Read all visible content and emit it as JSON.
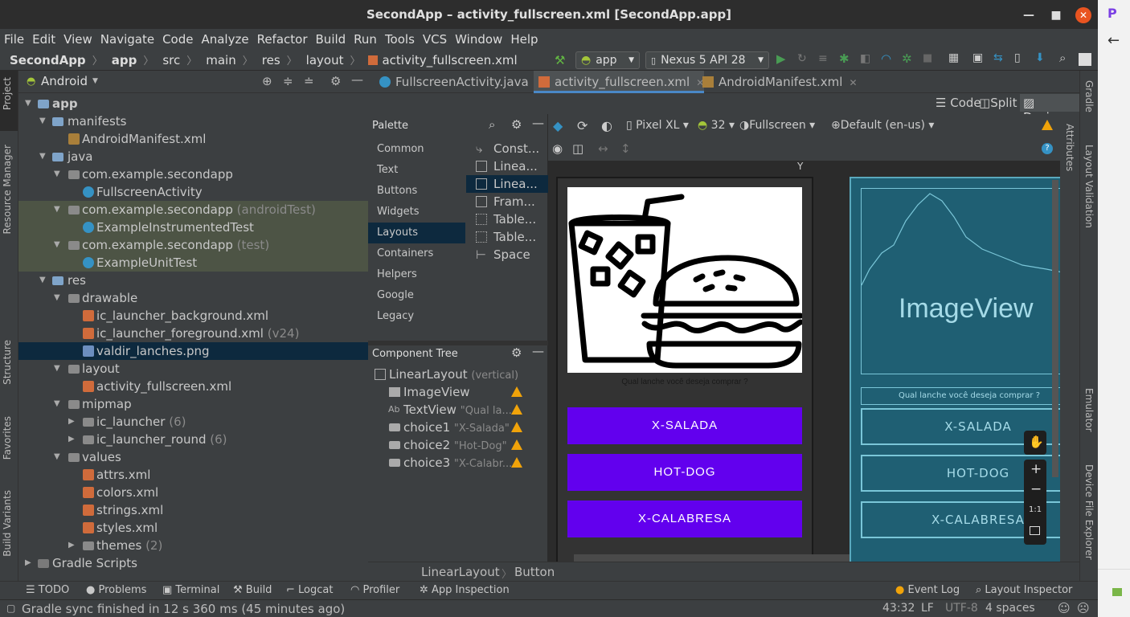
{
  "window": {
    "title": "SecondApp – activity_fullscreen.xml [SecondApp.app]"
  },
  "menu": [
    "File",
    "Edit",
    "View",
    "Navigate",
    "Code",
    "Analyze",
    "Refactor",
    "Build",
    "Run",
    "Tools",
    "VCS",
    "Window",
    "Help"
  ],
  "breadcrumb": [
    "SecondApp",
    "app",
    "src",
    "main",
    "res",
    "layout",
    "activity_fullscreen.xml"
  ],
  "run_config": "app",
  "device": "Nexus 5 API 28",
  "left_tabs": [
    "Project",
    "Resource Manager",
    "Structure",
    "Favorites",
    "Build Variants"
  ],
  "right_tabs": [
    "Gradle",
    "Layout Validation",
    "Emulator",
    "Device File Explorer"
  ],
  "project": {
    "view": "Android",
    "tree": [
      {
        "label": "app",
        "hint": ""
      },
      {
        "label": "manifests",
        "hint": ""
      },
      {
        "label": "AndroidManifest.xml",
        "hint": ""
      },
      {
        "label": "java",
        "hint": ""
      },
      {
        "label": "com.example.secondapp",
        "hint": ""
      },
      {
        "label": "FullscreenActivity",
        "hint": ""
      },
      {
        "label": "com.example.secondapp",
        "hint": "(androidTest)"
      },
      {
        "label": "ExampleInstrumentedTest",
        "hint": ""
      },
      {
        "label": "com.example.secondapp",
        "hint": "(test)"
      },
      {
        "label": "ExampleUnitTest",
        "hint": ""
      },
      {
        "label": "res",
        "hint": ""
      },
      {
        "label": "drawable",
        "hint": ""
      },
      {
        "label": "ic_launcher_background.xml",
        "hint": ""
      },
      {
        "label": "ic_launcher_foreground.xml",
        "hint": "(v24)"
      },
      {
        "label": "valdir_lanches.png",
        "hint": ""
      },
      {
        "label": "layout",
        "hint": ""
      },
      {
        "label": "activity_fullscreen.xml",
        "hint": ""
      },
      {
        "label": "mipmap",
        "hint": ""
      },
      {
        "label": "ic_launcher",
        "hint": "(6)"
      },
      {
        "label": "ic_launcher_round",
        "hint": "(6)"
      },
      {
        "label": "values",
        "hint": ""
      },
      {
        "label": "attrs.xml",
        "hint": ""
      },
      {
        "label": "colors.xml",
        "hint": ""
      },
      {
        "label": "strings.xml",
        "hint": ""
      },
      {
        "label": "styles.xml",
        "hint": ""
      },
      {
        "label": "themes",
        "hint": "(2)"
      },
      {
        "label": "Gradle Scripts",
        "hint": ""
      }
    ]
  },
  "editor_tabs": [
    "FullscreenActivity.java",
    "activity_fullscreen.xml",
    "AndroidManifest.xml"
  ],
  "modes": [
    "Code",
    "Split",
    "Design"
  ],
  "palette": {
    "title": "Palette",
    "categories": [
      "Common",
      "Text",
      "Buttons",
      "Widgets",
      "Layouts",
      "Containers",
      "Helpers",
      "Google",
      "Legacy"
    ],
    "items": [
      "Const...",
      "Linea...",
      "Linea...",
      "Fram...",
      "Table...",
      "Table...",
      "Space"
    ]
  },
  "component_tree": {
    "title": "Component Tree",
    "root": {
      "name": "LinearLayout",
      "hint": "(vertical)"
    },
    "items": [
      {
        "prefix": "",
        "name": "ImageView",
        "hint": ""
      },
      {
        "prefix": "Ab",
        "name": "TextView",
        "hint": "\"Qual la..."
      },
      {
        "prefix": "",
        "name": "choice1",
        "hint": "\"X-Salada\""
      },
      {
        "prefix": "",
        "name": "choice2",
        "hint": "\"Hot-Dog\""
      },
      {
        "prefix": "",
        "name": "choice3",
        "hint": "\"X-Calabr..."
      }
    ]
  },
  "design_toolbar": {
    "device": "Pixel XL",
    "api": "32",
    "theme": "Fullscreen",
    "locale": "Default (en-us)"
  },
  "attributes_tab": "Attributes",
  "preview": {
    "question": "Qual lanche você deseja comprar ?",
    "buttons": [
      "X-SALADA",
      "HOT-DOG",
      "X-CALABRESA"
    ],
    "blueprint_image_label": "ImageView",
    "zoom_one": "1:1"
  },
  "design_breadcrumb": [
    "LinearLayout",
    "Button"
  ],
  "tool_windows": [
    "TODO",
    "Problems",
    "Terminal",
    "Build",
    "Logcat",
    "Profiler",
    "App Inspection"
  ],
  "tool_windows_right": [
    "Event Log",
    "Layout Inspector"
  ],
  "status": {
    "message": "Gradle sync finished in 12 s 360 ms (45 minutes ago)",
    "position": "43:32",
    "line_sep": "LF",
    "encoding": "UTF-8",
    "indent": "4 spaces"
  },
  "colors": {
    "accent_purple": "#6200ee",
    "blueprint": "#1f5f73",
    "selection": "#0d293e",
    "warning": "#f0a30a"
  }
}
